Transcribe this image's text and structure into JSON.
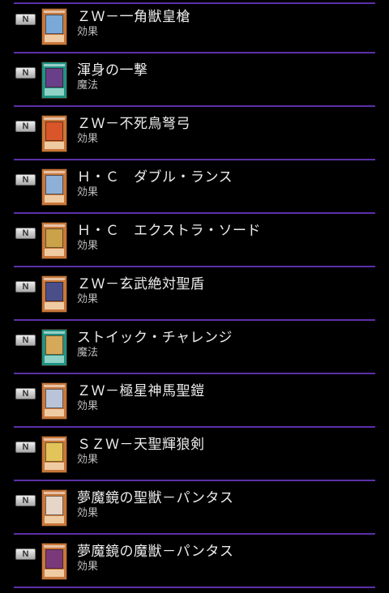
{
  "rarity_label": "N",
  "cards": [
    {
      "name": "ＺＷ－一角獣皇槍",
      "type": "効果",
      "frame": "monster",
      "art": "#7aa9d8"
    },
    {
      "name": "渾身の一撃",
      "type": "魔法",
      "frame": "spell",
      "art": "#6a3f8a"
    },
    {
      "name": "ＺＷ－不死鳥弩弓",
      "type": "効果",
      "frame": "monster",
      "art": "#d8562a"
    },
    {
      "name": "Ｈ・Ｃ　ダブル・ランス",
      "type": "効果",
      "frame": "monster",
      "art": "#8fb0d6"
    },
    {
      "name": "Ｈ・Ｃ　エクストラ・ソード",
      "type": "効果",
      "frame": "monster",
      "art": "#c9a24a"
    },
    {
      "name": "ＺＷ－玄武絶対聖盾",
      "type": "効果",
      "frame": "monster",
      "art": "#4a4f8a"
    },
    {
      "name": "ストイック・チャレンジ",
      "type": "魔法",
      "frame": "spell",
      "art": "#d6a85a"
    },
    {
      "name": "ＺＷ－極星神馬聖鎧",
      "type": "効果",
      "frame": "monster",
      "art": "#b9c4d8"
    },
    {
      "name": "ＳＺＷ－天聖輝狼剣",
      "type": "効果",
      "frame": "monster",
      "art": "#e3c45a"
    },
    {
      "name": "夢魔鏡の聖獣－パンタス",
      "type": "効果",
      "frame": "monster",
      "art": "#e6d6c8"
    },
    {
      "name": "夢魔鏡の魔獣－パンタス",
      "type": "効果",
      "frame": "monster",
      "art": "#7a3a7a"
    }
  ],
  "colors": {
    "divider": "#5c2fa8",
    "monster_frame": "#c8773a",
    "spell_frame": "#1e9384"
  }
}
